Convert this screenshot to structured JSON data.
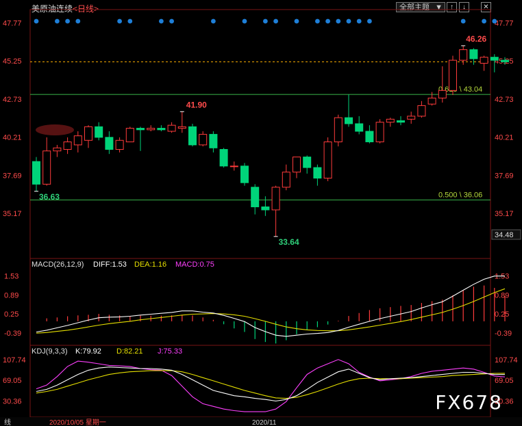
{
  "header": {
    "symbol": "美原油连续",
    "period_tag": "<日线>",
    "menu_label": "全部主题",
    "menu_arrow": "▼",
    "ctrl_buttons": [
      "↑",
      "↓",
      "✕"
    ]
  },
  "watermark": "FX678",
  "colors": {
    "up": "#ff3b3b",
    "down": "#00d47a",
    "fib": "#39b54a",
    "dash": "#ffb000",
    "diff": "#ffffff",
    "dea": "#e6e000",
    "macd_hist_neg": "#00d47a",
    "macd_hist_pos": "#ff3b3b",
    "k": "#ffffff",
    "d": "#e6e000",
    "j": "#ff40ff",
    "axis_text": "#ff4b4b",
    "dot": "#1e7fd8"
  },
  "chart_data": [
    {
      "type": "candlestick",
      "name": "price",
      "y_ticks": [
        "47.77",
        "45.25",
        "42.73",
        "40.21",
        "37.69",
        "35.17"
      ],
      "ylim": [
        33.0,
        48.2
      ],
      "current_price_label": "34.48",
      "fib_lines": [
        {
          "value": 43.04,
          "label": "0.618 \\ 43.04"
        },
        {
          "value": 36.06,
          "label": "0.500 \\ 36.06"
        }
      ],
      "dashed_line_value": 45.2,
      "high_marker": {
        "value": 46.26,
        "label": "46.26"
      },
      "mid_marker": {
        "value": 41.9,
        "label": "41.90"
      },
      "low_marker": {
        "value": 33.64,
        "label": "33.64"
      },
      "start_low_marker": {
        "value": 36.63,
        "label": "36.63"
      },
      "candles": [
        {
          "o": 38.6,
          "h": 38.9,
          "c": 37.1,
          "l": 36.63
        },
        {
          "o": 37.1,
          "h": 40.2,
          "c": 39.3,
          "l": 37.0
        },
        {
          "o": 39.3,
          "h": 39.7,
          "c": 39.5,
          "l": 38.9
        },
        {
          "o": 39.4,
          "h": 40.2,
          "c": 39.9,
          "l": 39.1
        },
        {
          "o": 39.7,
          "h": 40.6,
          "c": 40.3,
          "l": 39.2
        },
        {
          "o": 40.0,
          "h": 41.0,
          "c": 40.9,
          "l": 39.5
        },
        {
          "o": 40.9,
          "h": 41.2,
          "c": 40.2,
          "l": 40.0
        },
        {
          "o": 40.2,
          "h": 40.6,
          "c": 39.4,
          "l": 39.1
        },
        {
          "o": 39.4,
          "h": 40.2,
          "c": 40.0,
          "l": 39.2
        },
        {
          "o": 39.9,
          "h": 40.9,
          "c": 40.8,
          "l": 39.9
        },
        {
          "o": 40.8,
          "h": 40.9,
          "c": 40.7,
          "l": 39.3
        },
        {
          "o": 40.7,
          "h": 41.0,
          "c": 40.8,
          "l": 40.6
        },
        {
          "o": 40.8,
          "h": 41.0,
          "c": 40.7,
          "l": 40.6
        },
        {
          "o": 40.6,
          "h": 41.2,
          "c": 41.0,
          "l": 40.5
        },
        {
          "o": 40.8,
          "h": 41.9,
          "c": 40.9,
          "l": 40.5
        },
        {
          "o": 40.9,
          "h": 41.1,
          "c": 39.7,
          "l": 39.6
        },
        {
          "o": 39.7,
          "h": 40.6,
          "c": 40.4,
          "l": 39.6
        },
        {
          "o": 40.4,
          "h": 40.6,
          "c": 39.5,
          "l": 39.2
        },
        {
          "o": 39.4,
          "h": 39.5,
          "c": 38.3,
          "l": 38.2
        },
        {
          "o": 38.3,
          "h": 38.6,
          "c": 38.3,
          "l": 38.0
        },
        {
          "o": 38.3,
          "h": 38.5,
          "c": 37.2,
          "l": 37.0
        },
        {
          "o": 36.9,
          "h": 37.1,
          "c": 35.6,
          "l": 35.1
        },
        {
          "o": 35.6,
          "h": 36.3,
          "c": 35.4,
          "l": 35.0
        },
        {
          "o": 35.4,
          "h": 37.0,
          "c": 36.9,
          "l": 33.64
        },
        {
          "o": 36.9,
          "h": 38.4,
          "c": 37.9,
          "l": 36.7
        },
        {
          "o": 37.9,
          "h": 38.9,
          "c": 38.9,
          "l": 37.5
        },
        {
          "o": 38.9,
          "h": 39.0,
          "c": 38.2,
          "l": 37.8
        },
        {
          "o": 38.2,
          "h": 38.4,
          "c": 37.5,
          "l": 37.0
        },
        {
          "o": 37.5,
          "h": 40.2,
          "c": 39.9,
          "l": 37.3
        },
        {
          "o": 39.9,
          "h": 41.7,
          "c": 41.5,
          "l": 39.6
        },
        {
          "o": 41.5,
          "h": 43.04,
          "c": 41.1,
          "l": 40.9
        },
        {
          "o": 41.1,
          "h": 41.6,
          "c": 40.6,
          "l": 40.4
        },
        {
          "o": 40.6,
          "h": 41.0,
          "c": 39.9,
          "l": 39.8
        },
        {
          "o": 39.9,
          "h": 41.4,
          "c": 41.2,
          "l": 39.8
        },
        {
          "o": 41.2,
          "h": 41.5,
          "c": 41.4,
          "l": 40.9
        },
        {
          "o": 41.3,
          "h": 41.6,
          "c": 41.2,
          "l": 41.0
        },
        {
          "o": 41.4,
          "h": 41.9,
          "c": 41.6,
          "l": 41.1
        },
        {
          "o": 41.6,
          "h": 42.6,
          "c": 42.3,
          "l": 41.5
        },
        {
          "o": 42.4,
          "h": 43.2,
          "c": 42.8,
          "l": 42.3
        },
        {
          "o": 42.8,
          "h": 44.9,
          "c": 43.3,
          "l": 42.5
        },
        {
          "o": 43.3,
          "h": 45.6,
          "c": 45.3,
          "l": 43.0
        },
        {
          "o": 45.3,
          "h": 46.26,
          "c": 46.0,
          "l": 45.0
        },
        {
          "o": 46.0,
          "h": 46.1,
          "c": 45.4,
          "l": 45.0
        },
        {
          "o": 45.1,
          "h": 45.6,
          "c": 45.5,
          "l": 44.6
        },
        {
          "o": 45.5,
          "h": 45.7,
          "c": 45.3,
          "l": 44.5
        },
        {
          "o": 45.3,
          "h": 45.5,
          "c": 45.2,
          "l": 45.0
        }
      ],
      "event_dots": [
        0,
        2,
        3,
        4,
        8,
        9,
        12,
        13,
        17,
        20,
        22,
        23,
        25,
        27,
        28,
        29,
        30,
        31,
        32,
        41,
        43,
        44
      ]
    },
    {
      "type": "line",
      "name": "MACD",
      "title": "MACD(26,12,9)",
      "legend": [
        {
          "text": "DIFF:1.53",
          "color_key": "diff"
        },
        {
          "text": "DEA:1.16",
          "color_key": "dea"
        },
        {
          "text": "MACD:0.75",
          "color_key": "j"
        }
      ],
      "y_ticks": [
        "1.53",
        "0.89",
        "0.25",
        "-0.39"
      ],
      "ylim": [
        -0.65,
        1.8
      ],
      "diff": [
        -0.36,
        -0.3,
        -0.22,
        -0.14,
        -0.05,
        0.04,
        0.12,
        0.14,
        0.15,
        0.17,
        0.21,
        0.24,
        0.27,
        0.3,
        0.35,
        0.35,
        0.31,
        0.28,
        0.2,
        0.1,
        -0.01,
        -0.21,
        -0.35,
        -0.47,
        -0.51,
        -0.47,
        -0.43,
        -0.41,
        -0.38,
        -0.31,
        -0.2,
        -0.1,
        0.0,
        0.09,
        0.17,
        0.25,
        0.33,
        0.45,
        0.56,
        0.66,
        0.85,
        1.05,
        1.25,
        1.42,
        1.53,
        1.53
      ],
      "dea": [
        -0.4,
        -0.38,
        -0.34,
        -0.3,
        -0.25,
        -0.19,
        -0.13,
        -0.08,
        -0.04,
        0.0,
        0.05,
        0.09,
        0.13,
        0.17,
        0.21,
        0.24,
        0.25,
        0.26,
        0.25,
        0.22,
        0.17,
        0.09,
        0.0,
        -0.1,
        -0.19,
        -0.25,
        -0.29,
        -0.31,
        -0.32,
        -0.32,
        -0.29,
        -0.24,
        -0.19,
        -0.13,
        -0.07,
        -0.01,
        0.06,
        0.14,
        0.22,
        0.3,
        0.41,
        0.53,
        0.67,
        0.82,
        0.97,
        1.1
      ],
      "hist": [
        0.0,
        0.1,
        0.13,
        0.17,
        0.2,
        0.22,
        0.25,
        0.22,
        0.2,
        0.18,
        0.19,
        0.19,
        0.19,
        0.2,
        0.22,
        0.2,
        0.13,
        0.05,
        -0.1,
        -0.24,
        -0.36,
        -0.6,
        -0.7,
        -0.75,
        -0.64,
        -0.44,
        -0.28,
        -0.2,
        -0.11,
        0.02,
        0.18,
        0.28,
        0.38,
        0.44,
        0.48,
        0.52,
        0.55,
        0.62,
        0.68,
        0.73,
        0.88,
        1.04,
        1.17,
        1.21,
        1.13,
        0.86
      ]
    },
    {
      "type": "line",
      "name": "KDJ",
      "title": "KDJ(9,3,3)",
      "legend": [
        {
          "text": "K:79.92",
          "color_key": "k"
        },
        {
          "text": "D:82.21",
          "color_key": "d"
        },
        {
          "text": "J:75.33",
          "color_key": "j"
        }
      ],
      "y_ticks": [
        "107.74",
        "69.05",
        "30.36"
      ],
      "ylim": [
        5,
        118
      ],
      "k": [
        48,
        52,
        60,
        70,
        80,
        88,
        92,
        94,
        93,
        92,
        91,
        91,
        90,
        88,
        80,
        70,
        60,
        50,
        45,
        40,
        38,
        35,
        33,
        30,
        33,
        40,
        52,
        65,
        75,
        85,
        90,
        82,
        74,
        70,
        72,
        73,
        74,
        76,
        78,
        80,
        82,
        84,
        84,
        82,
        80,
        79.92
      ],
      "d": [
        45,
        48,
        52,
        58,
        64,
        70,
        75,
        80,
        83,
        85,
        86,
        87,
        87,
        87,
        85,
        80,
        74,
        68,
        62,
        56,
        50,
        45,
        40,
        36,
        35,
        37,
        42,
        48,
        55,
        62,
        68,
        72,
        73,
        72,
        72,
        72,
        73,
        74,
        75,
        76,
        78,
        79,
        80,
        81,
        82,
        82.21
      ],
      "j": [
        53,
        60,
        76,
        95,
        105,
        103,
        100,
        97,
        96,
        95,
        91,
        89,
        88,
        78,
        58,
        38,
        25,
        20,
        15,
        12,
        10,
        10,
        10,
        15,
        29,
        55,
        80,
        92,
        100,
        108,
        100,
        84,
        75,
        68,
        70,
        72,
        76,
        82,
        86,
        88,
        90,
        92,
        90,
        84,
        77,
        75.33
      ]
    }
  ],
  "footer": {
    "left_label": "线",
    "date_start": "2020/10/05 星期一",
    "date_mid": "2020/11"
  }
}
